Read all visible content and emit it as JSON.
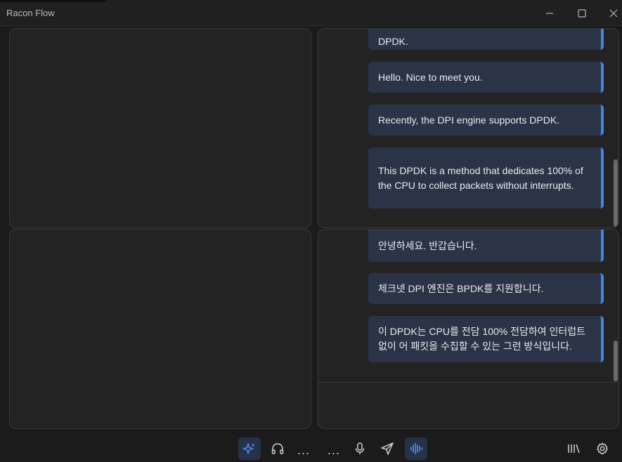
{
  "window": {
    "title": "Racon Flow",
    "controls": [
      "minimize-icon",
      "maximize-icon",
      "close-icon"
    ]
  },
  "top_chat": {
    "messages": [
      {
        "text": "DPDK."
      },
      {
        "text": "Hello. Nice to meet you."
      },
      {
        "text": "Recently, the DPI engine supports DPDK."
      },
      {
        "text": "This DPDK is a method that dedicates 100% of the CPU to collect packets without interrupts."
      }
    ]
  },
  "bottom_chat": {
    "messages": [
      {
        "text": "안녕하세요. 반갑습니다."
      },
      {
        "text": "체크넷 DPI 엔진은 BPDK를 지원합니다."
      },
      {
        "text": "이 DPDK는 CPU를 전담 100% 전담하여 인터럽트 없이 어 패킷을 수집할 수 있는 그런 방식입니다."
      }
    ]
  },
  "toolbar": {
    "items": [
      {
        "icon": "sparkle-icon",
        "active": true
      },
      {
        "icon": "headphones-icon",
        "active": false
      },
      {
        "icon": "more-icon",
        "label": "..."
      },
      {
        "icon": "more-icon",
        "label": "..."
      },
      {
        "icon": "microphone-icon",
        "active": false
      },
      {
        "icon": "send-icon",
        "active": false
      },
      {
        "icon": "audio-wave-icon",
        "active": true
      },
      {
        "icon": "library-icon",
        "active": false
      },
      {
        "icon": "gear-icon",
        "active": false
      }
    ]
  },
  "colors": {
    "bubble_bg": "#2a3446",
    "bubble_accent": "#3f86e8",
    "active_button_bg": "#25324a",
    "icon_accent": "#4f8ff2"
  }
}
